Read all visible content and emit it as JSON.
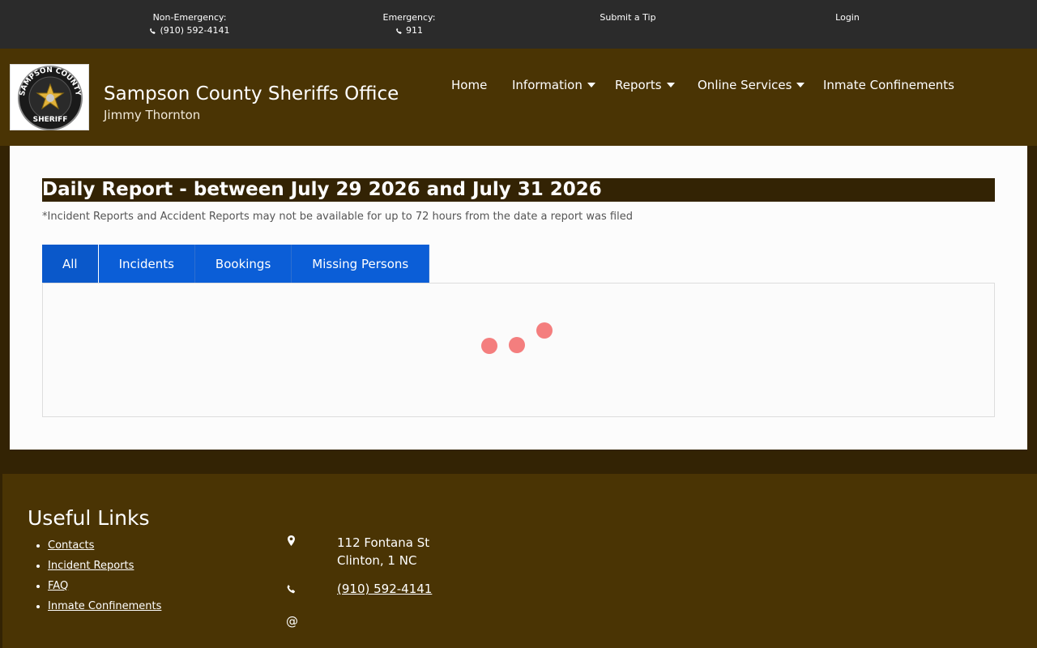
{
  "topbar": {
    "non_emergency_label": "Non-Emergency:",
    "non_emergency_phone": "(910) 592-4141",
    "emergency_label": "Emergency:",
    "emergency_phone": "911",
    "submit_tip": "Submit a Tip",
    "login": "Login"
  },
  "header": {
    "logo_icon": "sheriff-badge-icon",
    "logo_text_top": "SAMPSON COUNTY",
    "logo_text_bottom": "SHERIFF",
    "title": "Sampson County Sheriffs Office",
    "subtitle": "Jimmy Thornton"
  },
  "nav": {
    "items": [
      {
        "label": "Home"
      },
      {
        "label": "Information"
      },
      {
        "label": "Reports"
      },
      {
        "label": "Online Services"
      },
      {
        "label": "Inmate Confinements"
      }
    ]
  },
  "report": {
    "title": "Daily Report - between July 29 2026 and July 31 2026",
    "disclaimer": "*Incident Reports and Accident Reports may not be available for up to 72 hours from the date a report was filed",
    "tabs": [
      {
        "label": "All",
        "active": true
      },
      {
        "label": "Incidents",
        "active": false
      },
      {
        "label": "Bookings",
        "active": false
      },
      {
        "label": "Missing Persons",
        "active": false
      }
    ],
    "loading_indicator_color": "#f47e7e"
  },
  "footer": {
    "useful_links_heading": "Useful Links",
    "links": [
      {
        "label": "Contacts"
      },
      {
        "label": "Incident Reports"
      },
      {
        "label": "FAQ"
      },
      {
        "label": "Inmate Confinements"
      }
    ],
    "address_line1": "112 Fontana St",
    "address_line2": "Clinton, 1 NC",
    "phone": "(910) 592-4141",
    "email_symbol": "@"
  },
  "colors": {
    "top_bar": "#2b2b2b",
    "brand_brown": "#4a3404",
    "dark_brown": "#332304",
    "tab_blue": "#0b5ed7"
  }
}
